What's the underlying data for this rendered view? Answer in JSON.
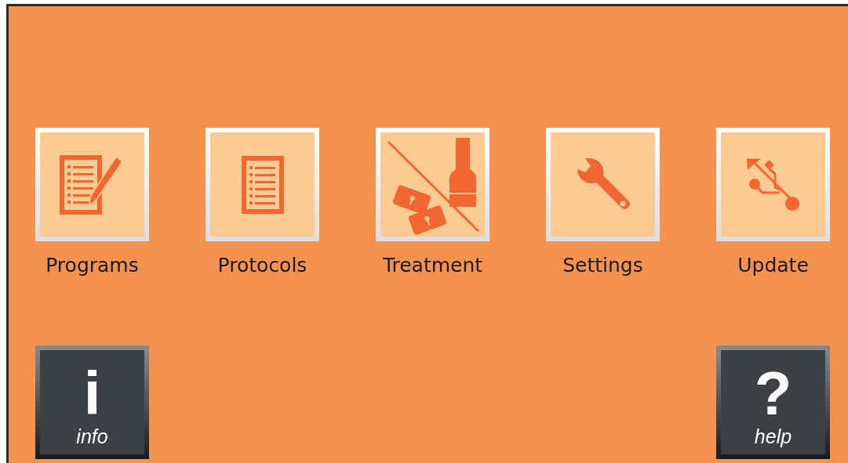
{
  "menu": [
    {
      "label": "Programs",
      "kind": "edit-list"
    },
    {
      "label": "Protocols",
      "kind": "list"
    },
    {
      "label": "Treatment",
      "kind": "treatment"
    },
    {
      "label": "Settings",
      "kind": "wrench"
    },
    {
      "label": "Update",
      "kind": "usb"
    }
  ],
  "bottom_buttons": [
    {
      "glyph": "i",
      "label": "info"
    },
    {
      "glyph": "?",
      "label": "help"
    }
  ]
}
